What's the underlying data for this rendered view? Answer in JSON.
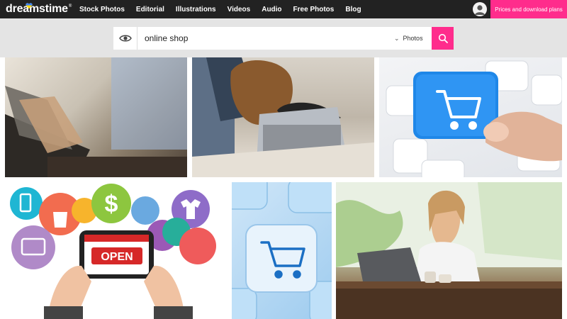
{
  "brand": {
    "logo_text": "dreamstime",
    "registered_mark": "®"
  },
  "nav": {
    "items": [
      "Stock Photos",
      "Editorial",
      "Illustrations",
      "Videos",
      "Audio",
      "Free Photos",
      "Blog"
    ]
  },
  "header": {
    "pricing_label": "Prices and download plans",
    "accent_color": "#ff2c8c"
  },
  "search": {
    "query": "online shop",
    "media_type": "Photos",
    "icons": [
      "eye-icon",
      "chevron-down-icon",
      "search-icon"
    ]
  },
  "results": [
    {
      "id": 1,
      "subject": "woman-writing-at-laptop"
    },
    {
      "id": 2,
      "subject": "dog-with-laptop"
    },
    {
      "id": 3,
      "subject": "cart-key-on-keyboard"
    },
    {
      "id": 4,
      "subject": "open-sign-with-shopping-icons",
      "sign_text": "OPEN"
    },
    {
      "id": 5,
      "subject": "cart-key-closeup"
    },
    {
      "id": 6,
      "subject": "woman-with-laptop-in-cafe"
    }
  ]
}
